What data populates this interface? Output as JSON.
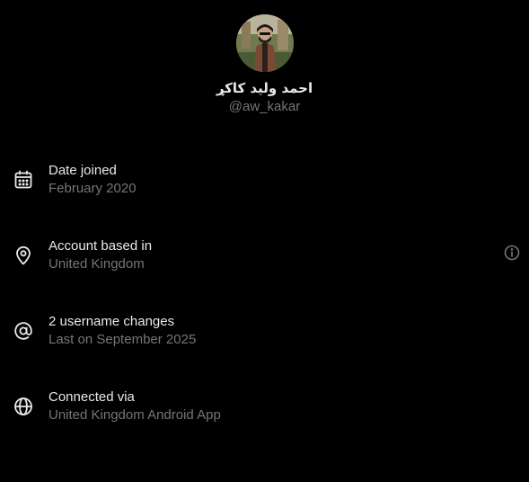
{
  "profile": {
    "display_name": "احمد وليد كاكړ",
    "handle": "@aw_kakar"
  },
  "rows": [
    {
      "icon": "calendar-icon",
      "title": "Date joined",
      "subtitle": "February 2020"
    },
    {
      "icon": "location-pin-icon",
      "title": "Account based in",
      "subtitle": "United Kingdom"
    },
    {
      "icon": "at-sign-icon",
      "title": "2 username changes",
      "subtitle": "Last on September 2025"
    },
    {
      "icon": "globe-icon",
      "title": "Connected via",
      "subtitle": "United Kingdom Android App"
    }
  ],
  "colors": {
    "background": "#000000",
    "primary_text": "#e7e9ea",
    "secondary_text": "#71767b"
  }
}
